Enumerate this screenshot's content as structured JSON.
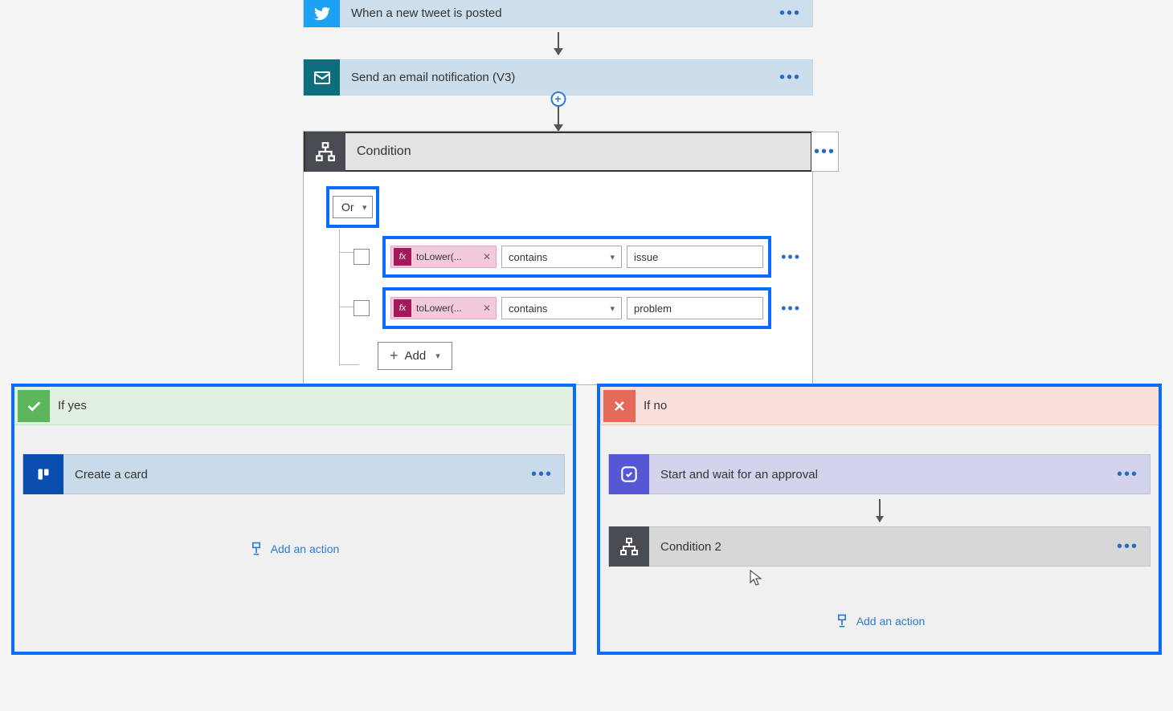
{
  "trigger": {
    "title": "When a new tweet is posted"
  },
  "email": {
    "title": "Send an email notification (V3)"
  },
  "condition": {
    "title": "Condition",
    "group_op": "Or",
    "rows": [
      {
        "fx": "toLower(...",
        "op": "contains",
        "value": "issue"
      },
      {
        "fx": "toLower(...",
        "op": "contains",
        "value": "problem"
      }
    ],
    "add_label": "Add"
  },
  "branches": {
    "yes": {
      "label": "If yes",
      "steps": [
        {
          "kind": "trello",
          "title": "Create a card"
        }
      ],
      "add_action": "Add an action"
    },
    "no": {
      "label": "If no",
      "steps": [
        {
          "kind": "approval",
          "title": "Start and wait for an approval"
        },
        {
          "kind": "cond2",
          "title": "Condition 2"
        }
      ],
      "add_action": "Add an action"
    }
  }
}
